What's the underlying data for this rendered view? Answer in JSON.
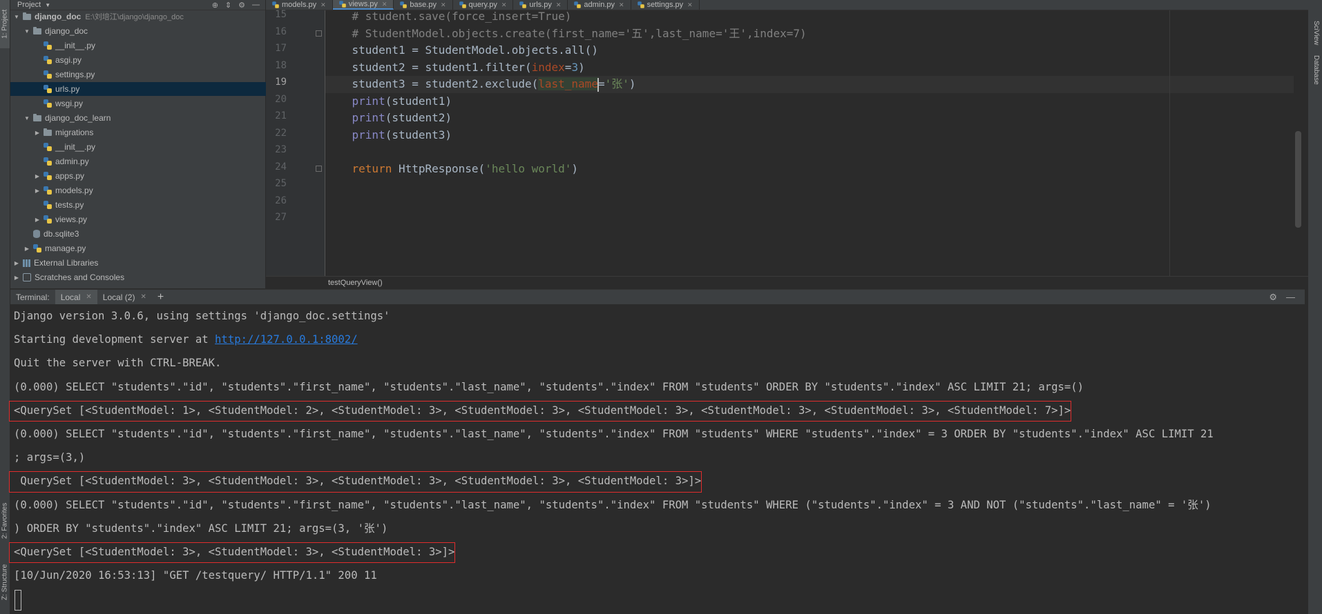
{
  "left_stripe": {
    "project_tab": "1: Project",
    "favorites_tab": "2: Favorites",
    "structure_tab": "Z: Structure"
  },
  "right_stripe": {
    "sciview_tab": "SciView",
    "database_tab": "Database"
  },
  "project": {
    "header_label": "Project",
    "tree": [
      {
        "label": "django_doc",
        "hint": "E:\\刘培江\\django\\django_doc",
        "kind": "folder",
        "indent": 0,
        "arrow": "▼",
        "bold": true
      },
      {
        "label": "django_doc",
        "kind": "folder",
        "indent": 1,
        "arrow": "▼"
      },
      {
        "label": "__init__.py",
        "kind": "py",
        "indent": 2,
        "arrow": ""
      },
      {
        "label": "asgi.py",
        "kind": "py",
        "indent": 2,
        "arrow": ""
      },
      {
        "label": "settings.py",
        "kind": "py",
        "indent": 2,
        "arrow": ""
      },
      {
        "label": "urls.py",
        "kind": "py",
        "indent": 2,
        "arrow": "",
        "selected": true
      },
      {
        "label": "wsgi.py",
        "kind": "py",
        "indent": 2,
        "arrow": ""
      },
      {
        "label": "django_doc_learn",
        "kind": "folder",
        "indent": 1,
        "arrow": "▼"
      },
      {
        "label": "migrations",
        "kind": "folder",
        "indent": 2,
        "arrow": "▶"
      },
      {
        "label": "__init__.py",
        "kind": "py",
        "indent": 2,
        "arrow": ""
      },
      {
        "label": "admin.py",
        "kind": "py",
        "indent": 2,
        "arrow": ""
      },
      {
        "label": "apps.py",
        "kind": "py",
        "indent": 2,
        "arrow": "▶"
      },
      {
        "label": "models.py",
        "kind": "py",
        "indent": 2,
        "arrow": "▶"
      },
      {
        "label": "tests.py",
        "kind": "py",
        "indent": 2,
        "arrow": ""
      },
      {
        "label": "views.py",
        "kind": "py",
        "indent": 2,
        "arrow": "▶"
      },
      {
        "label": "db.sqlite3",
        "kind": "db",
        "indent": 1,
        "arrow": ""
      },
      {
        "label": "manage.py",
        "kind": "py",
        "indent": 1,
        "arrow": "▶"
      },
      {
        "label": "External Libraries",
        "kind": "lib",
        "indent": 0,
        "arrow": "▶"
      },
      {
        "label": "Scratches and Consoles",
        "kind": "scratch",
        "indent": 0,
        "arrow": "▶"
      }
    ]
  },
  "editor": {
    "tabs": [
      {
        "label": "models.py"
      },
      {
        "label": "views.py",
        "active": true
      },
      {
        "label": "base.py"
      },
      {
        "label": "query.py"
      },
      {
        "label": "urls.py"
      },
      {
        "label": "admin.py"
      },
      {
        "label": "settings.py"
      }
    ],
    "line_numbers": [
      "15",
      "16",
      "17",
      "18",
      "19",
      "20",
      "21",
      "22",
      "23",
      "24",
      "25",
      "26",
      "27"
    ],
    "current_line_index": 4,
    "lines": [
      [
        {
          "t": "    # student.save(force_insert=True)",
          "c": "comment"
        }
      ],
      [
        {
          "t": "    # StudentModel.objects.create(first_name='五',last_name='王',index=7)",
          "c": "comment"
        }
      ],
      [
        {
          "t": "    student1 = StudentModel.objects.all()",
          "c": ""
        }
      ],
      [
        {
          "t": "    student2 = student1.filter(",
          "c": ""
        },
        {
          "t": "index",
          "c": "param"
        },
        {
          "t": "=",
          "c": ""
        },
        {
          "t": "3",
          "c": "num"
        },
        {
          "t": ")",
          "c": ""
        }
      ],
      [
        {
          "t": "    student3 = student2.exclude(",
          "c": ""
        },
        {
          "t": "last_name",
          "c": "param hl"
        },
        {
          "t": "|",
          "c": "caret"
        },
        {
          "t": "=",
          "c": ""
        },
        {
          "t": "'张'",
          "c": "str"
        },
        {
          "t": ")",
          "c": ""
        }
      ],
      [
        {
          "t": "    ",
          "c": ""
        },
        {
          "t": "print",
          "c": "builtin"
        },
        {
          "t": "(student1)",
          "c": ""
        }
      ],
      [
        {
          "t": "    ",
          "c": ""
        },
        {
          "t": "print",
          "c": "builtin"
        },
        {
          "t": "(student2)",
          "c": ""
        }
      ],
      [
        {
          "t": "    ",
          "c": ""
        },
        {
          "t": "print",
          "c": "builtin"
        },
        {
          "t": "(student3)",
          "c": ""
        }
      ],
      [
        {
          "t": "",
          "c": ""
        }
      ],
      [
        {
          "t": "    ",
          "c": ""
        },
        {
          "t": "return",
          "c": "kw"
        },
        {
          "t": " HttpResponse(",
          "c": ""
        },
        {
          "t": "'hello world'",
          "c": "str"
        },
        {
          "t": ")",
          "c": ""
        }
      ],
      [
        {
          "t": "",
          "c": ""
        }
      ],
      [
        {
          "t": "",
          "c": ""
        }
      ],
      [
        {
          "t": "",
          "c": ""
        }
      ]
    ],
    "breadcrumb": "testQueryView()"
  },
  "terminal": {
    "title": "Terminal:",
    "tabs": [
      {
        "label": "Local",
        "active": true
      },
      {
        "label": "Local (2)"
      }
    ],
    "add_label": "+",
    "lines": [
      {
        "text": "Django version 3.0.6, using settings 'django_doc.settings'"
      },
      {
        "text": "Starting development server at ",
        "link": "http://127.0.0.1:8002/"
      },
      {
        "text": "Quit the server with CTRL-BREAK."
      },
      {
        "text": "(0.000) SELECT \"students\".\"id\", \"students\".\"first_name\", \"students\".\"last_name\", \"students\".\"index\" FROM \"students\" ORDER BY \"students\".\"index\" ASC LIMIT 21; args=()"
      },
      {
        "text": "<QuerySet [<StudentModel: 1>, <StudentModel: 2>, <StudentModel: 3>, <StudentModel: 3>, <StudentModel: 3>, <StudentModel: 3>, <StudentModel: 3>, <StudentModel: 7>]>",
        "boxed": true
      },
      {
        "text": "(0.000) SELECT \"students\".\"id\", \"students\".\"first_name\", \"students\".\"last_name\", \"students\".\"index\" FROM \"students\" WHERE \"students\".\"index\" = 3 ORDER BY \"students\".\"index\" ASC LIMIT 21"
      },
      {
        "text": "; args=(3,)"
      },
      {
        "text": " QuerySet [<StudentModel: 3>, <StudentModel: 3>, <StudentModel: 3>, <StudentModel: 3>, <StudentModel: 3>]>",
        "boxed": true
      },
      {
        "text": "(0.000) SELECT \"students\".\"id\", \"students\".\"first_name\", \"students\".\"last_name\", \"students\".\"index\" FROM \"students\" WHERE (\"students\".\"index\" = 3 AND NOT (\"students\".\"last_name\" = '张')"
      },
      {
        "text": ") ORDER BY \"students\".\"index\" ASC LIMIT 21; args=(3, '张')"
      },
      {
        "text": "<QuerySet [<StudentModel: 3>, <StudentModel: 3>, <StudentModel: 3>]>",
        "boxed": true
      },
      {
        "text": "[10/Jun/2020 16:53:13] \"GET /testquery/ HTTP/1.1\" 200 11"
      }
    ]
  }
}
